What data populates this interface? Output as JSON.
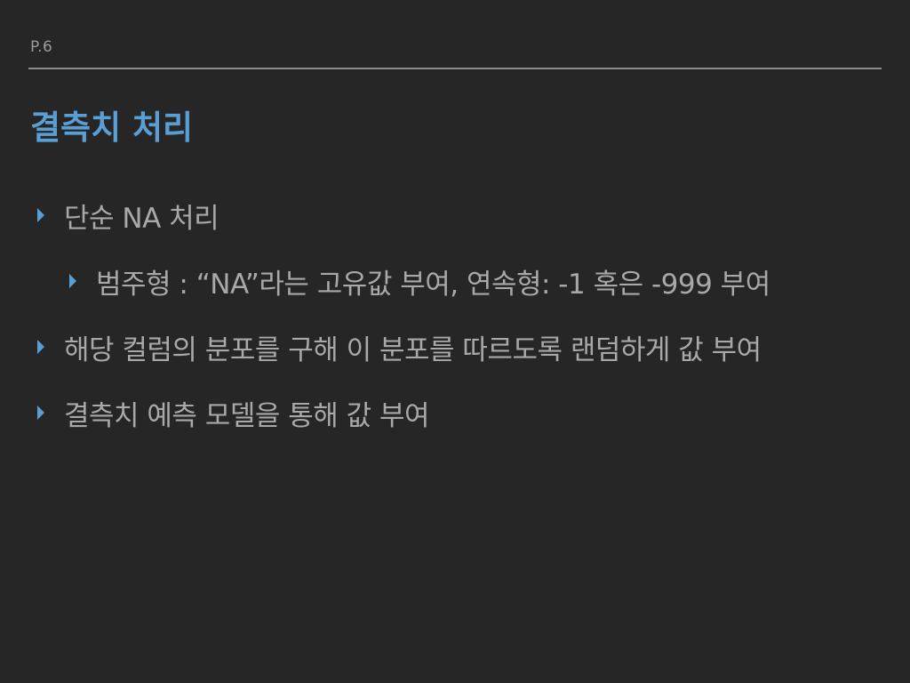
{
  "slide": {
    "page_number": "P.6",
    "title": "결측치 처리",
    "accent_color": "#5a9fd4",
    "background_color": "#262626",
    "bullets": [
      {
        "text": "단순 NA 처리",
        "icon": "triangle-right-icon"
      },
      {
        "text": "범주형 : “NA”라는 고유값 부여, 연속형: -1 혹은 -999 부여",
        "icon": "triangle-right-icon"
      },
      {
        "text": "해당 컬럼의 분포를 구해 이 분포를 따르도록 랜덤하게 값 부여",
        "icon": "triangle-right-icon"
      },
      {
        "text": "결측치 예측 모델을 통해 값 부여",
        "icon": "triangle-right-icon"
      }
    ]
  }
}
